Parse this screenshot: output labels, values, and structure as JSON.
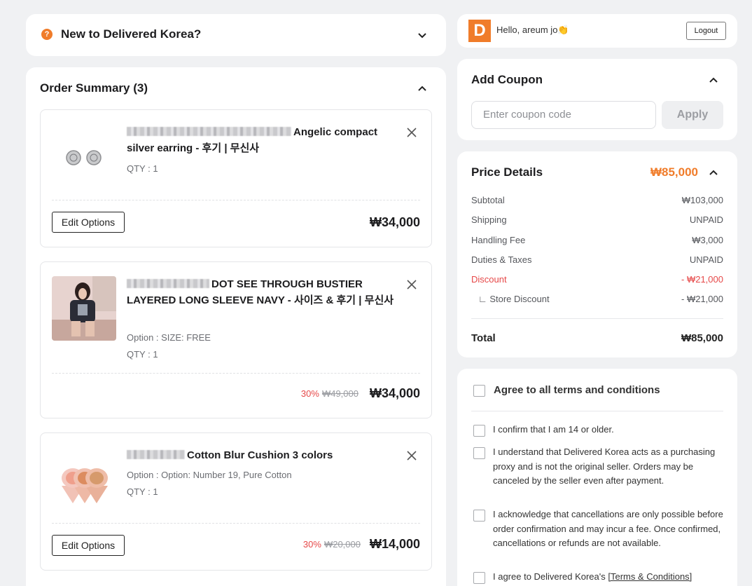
{
  "new_to": {
    "title": "New to Delivered Korea?",
    "icon": "question-icon"
  },
  "order_summary": {
    "title": "Order Summary (3)",
    "items": [
      {
        "name": "Angelic compact silver earring - 후기 | 무신사",
        "qty": "QTY : 1",
        "edit_label": "Edit Options",
        "price": "₩34,000"
      },
      {
        "name": "DOT SEE THROUGH BUSTIER LAYERED LONG SLEEVE NAVY - 사이즈 & 후기 | 무신사",
        "option": "Option : SIZE: FREE",
        "qty": "QTY : 1",
        "discount_pct": "30%",
        "original_price": "₩49,000",
        "price": "₩34,000"
      },
      {
        "name": "Cotton Blur Cushion 3 colors",
        "option": "Option : Option: Number 19, Pure Cotton",
        "qty": "QTY : 1",
        "edit_label": "Edit Options",
        "discount_pct": "30%",
        "original_price": "₩20,000",
        "price": "₩14,000"
      }
    ]
  },
  "user": {
    "logo": "D",
    "greeting": "Hello, areum jo👏",
    "logout_label": "Logout"
  },
  "coupon": {
    "title": "Add Coupon",
    "placeholder": "Enter coupon code",
    "apply_label": "Apply"
  },
  "price_details": {
    "title": "Price Details",
    "total_header": "₩85,000",
    "rows": [
      {
        "label": "Subtotal",
        "value": "₩103,000"
      },
      {
        "label": "Shipping",
        "value": "UNPAID"
      },
      {
        "label": "Handling Fee",
        "value": "₩3,000"
      },
      {
        "label": "Duties & Taxes",
        "value": "UNPAID"
      },
      {
        "label": "Discount",
        "value": "- ₩21,000"
      },
      {
        "label": "∟ Store Discount",
        "value": "- ₩21,000"
      }
    ],
    "total_label": "Total",
    "total_value": "₩85,000"
  },
  "terms": {
    "agree_all": "Agree to all terms and conditions",
    "items": [
      "I confirm that I am 14 or older.",
      "I understand that Delivered Korea acts as a purchasing proxy and is not the original seller. Orders may be canceled by the seller even after payment.",
      "I acknowledge that cancellations are only possible before order confirmation and may incur a fee. Once confirmed, cancellations or refunds are not available."
    ],
    "last_prefix": "I agree to Delivered Korea's ",
    "last_link": "[Terms & Conditions]"
  },
  "colors": {
    "accent": "#f07c2a",
    "discount_red": "#e64848"
  }
}
